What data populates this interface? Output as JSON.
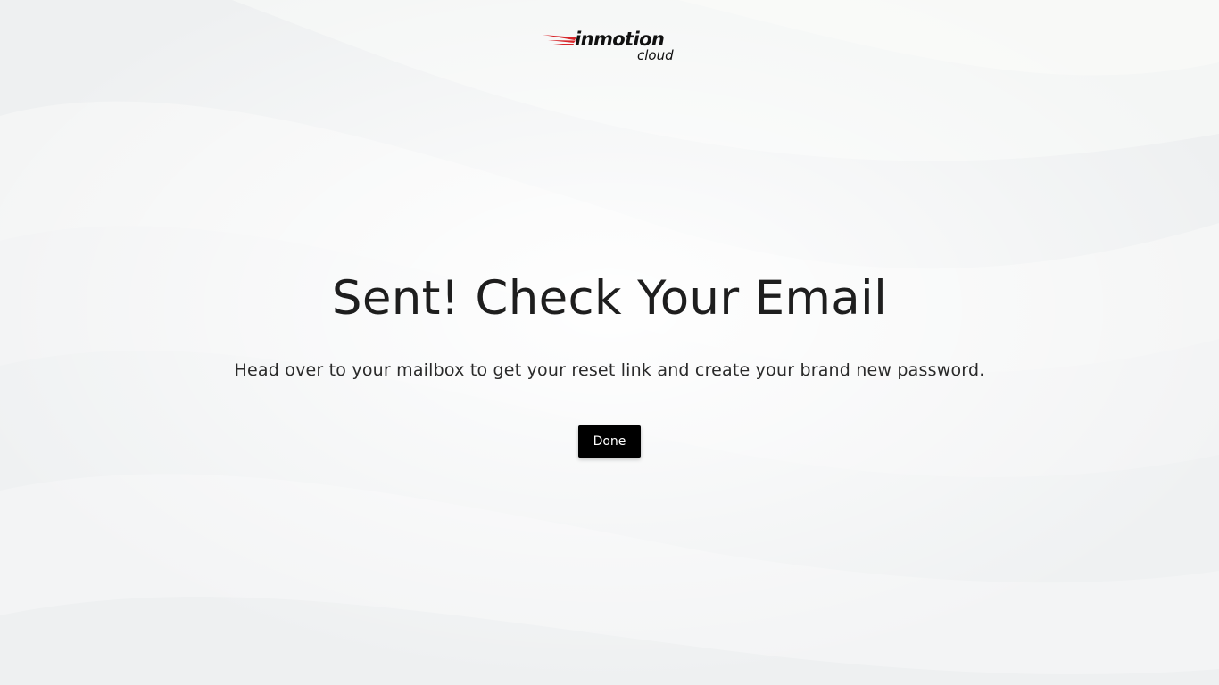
{
  "brand": {
    "name": "inmotion",
    "product": "cloud",
    "accent_color": "#d7262b",
    "logo_icon": "speed-lines-icon"
  },
  "main": {
    "title": "Sent! Check Your Email",
    "message": "Head over to your mailbox to get your reset link and create your brand new password.",
    "done_label": "Done"
  },
  "colors": {
    "background": "#f1f2f3",
    "button_bg": "#000000",
    "button_text": "#ffffff"
  }
}
